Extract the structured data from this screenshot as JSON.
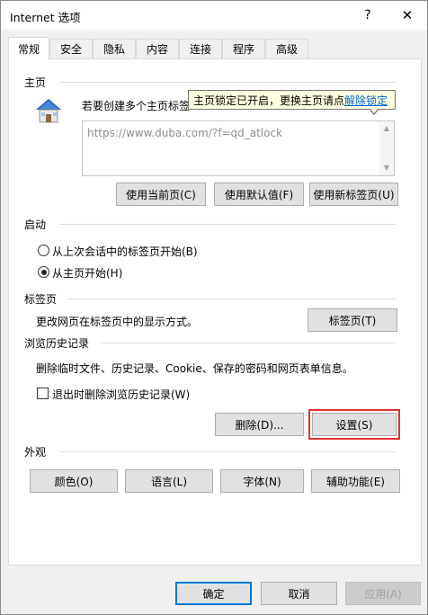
{
  "window": {
    "title": "Internet 选项",
    "help": "?",
    "close": "✕"
  },
  "tabs": [
    "常规",
    "安全",
    "隐私",
    "内容",
    "连接",
    "程序",
    "高级"
  ],
  "homepage": {
    "section_label": "主页",
    "description": "若要创建多个主页标签",
    "url": "https://www.duba.com/?f=qd_atlock",
    "tooltip_text": "主页锁定已开启，更换主页请点",
    "tooltip_link": "解除锁定",
    "buttons": [
      "使用当前页(C)",
      "使用默认值(F)",
      "使用新标签页(U)"
    ]
  },
  "startup": {
    "section_label": "启动",
    "options": [
      "从上次会话中的标签页开始(B)",
      "从主页开始(H)"
    ],
    "selected_index": 1
  },
  "tabs_section": {
    "section_label": "标签页",
    "description": "更改网页在标签页中的显示方式。",
    "button": "标签页(T)"
  },
  "history": {
    "section_label": "浏览历史记录",
    "description": "删除临时文件、历史记录、Cookie、保存的密码和网页表单信息。",
    "checkbox_label": "退出时删除浏览历史记录(W)",
    "checkbox_checked": false,
    "delete_button": "删除(D)...",
    "settings_button": "设置(S)"
  },
  "appearance": {
    "section_label": "外观",
    "buttons": [
      "颜色(O)",
      "语言(L)",
      "字体(N)",
      "辅助功能(E)"
    ]
  },
  "footer": {
    "ok": "确定",
    "cancel": "取消",
    "apply": "应用(A)"
  },
  "colors": {
    "link": "#0066cc",
    "tooltip_bg": "#ffffe1",
    "highlight_ring": "#e03030",
    "default_button_border": "#0078d7"
  }
}
